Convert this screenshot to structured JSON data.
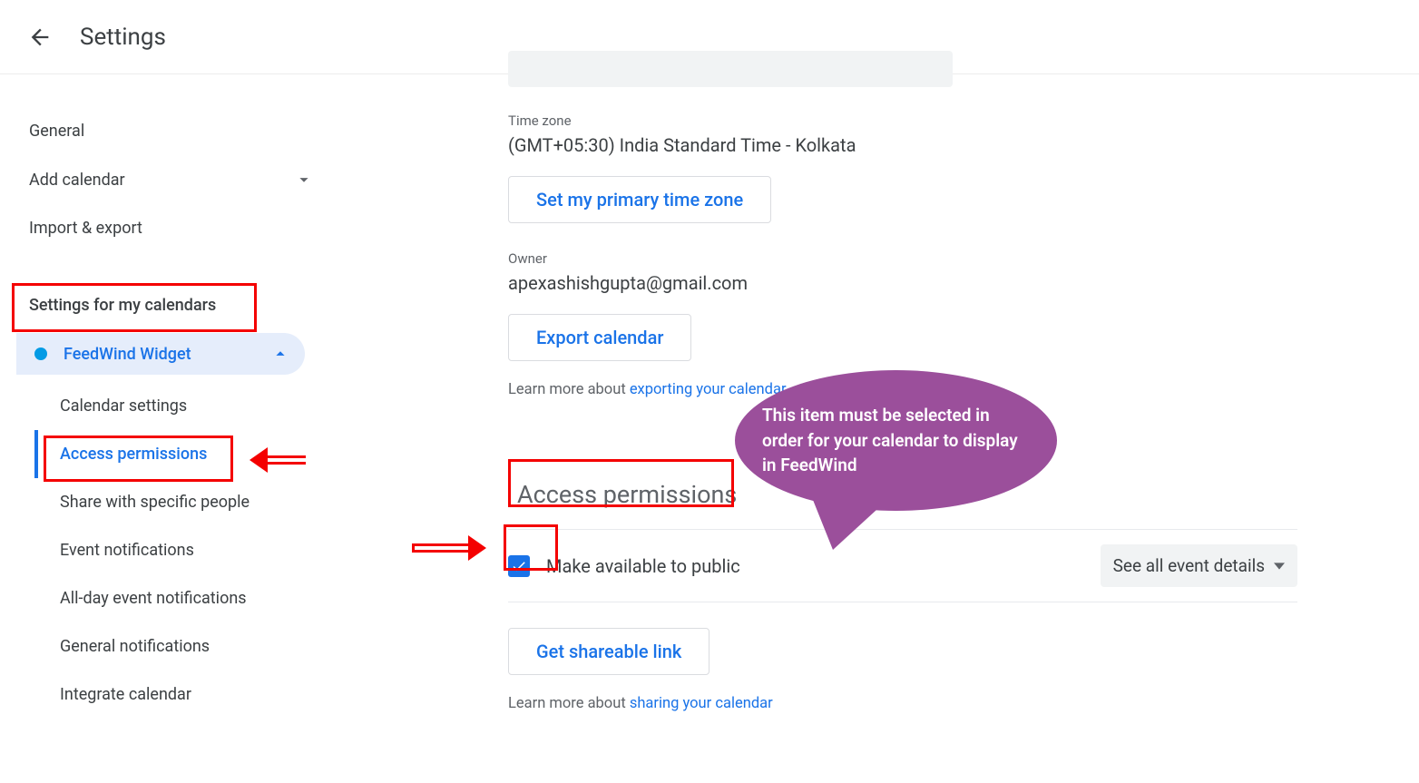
{
  "header": {
    "title": "Settings"
  },
  "sidebar": {
    "items": [
      {
        "label": "General"
      },
      {
        "label": "Add calendar"
      },
      {
        "label": "Import & export"
      }
    ],
    "section_heading": "Settings for my calendars",
    "calendar": {
      "name": "FeedWind Widget",
      "subitems": [
        {
          "label": "Calendar settings"
        },
        {
          "label": "Access permissions"
        },
        {
          "label": "Share with specific people"
        },
        {
          "label": "Event notifications"
        },
        {
          "label": "All-day event notifications"
        },
        {
          "label": "General notifications"
        },
        {
          "label": "Integrate calendar"
        }
      ]
    }
  },
  "main": {
    "timezone": {
      "label": "Time zone",
      "value": "(GMT+05:30) India Standard Time - Kolkata",
      "button": "Set my primary time zone"
    },
    "owner": {
      "label": "Owner",
      "value": "apexashishgupta@gmail.com"
    },
    "export": {
      "button": "Export calendar",
      "helper_prefix": "Learn more about ",
      "helper_link": "exporting your calendar"
    },
    "access": {
      "section_title": "Access permissions",
      "checkbox_label": "Make available to public",
      "dropdown_label": "See all event details",
      "share_button": "Get shareable link",
      "helper_prefix": "Learn more about ",
      "helper_link": "sharing your calendar"
    }
  },
  "annotation": {
    "callout_text": "This item must be selected in order for your calendar to display in FeedWind"
  }
}
